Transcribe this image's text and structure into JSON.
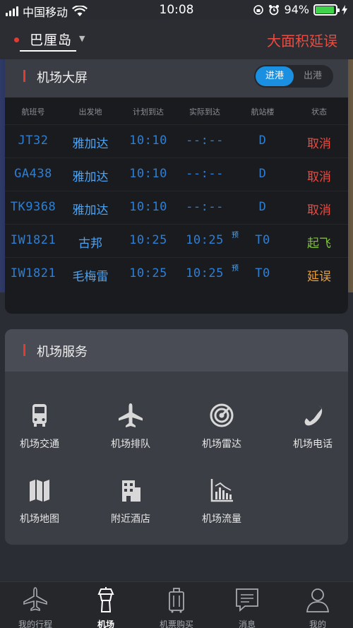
{
  "status": {
    "carrier": "中国移动",
    "time": "10:08",
    "battery": "94%",
    "battery_level": 0.94
  },
  "header": {
    "location": "巴厘岛",
    "delay_link": "大面积延误"
  },
  "board": {
    "title": "机场大屏",
    "toggle": {
      "arrive": "进港",
      "depart": "出港"
    },
    "columns": [
      "航班号",
      "出发地",
      "计划到达",
      "实际到达",
      "航站楼",
      "状态"
    ],
    "flights": [
      {
        "no": "JT32",
        "from": "雅加达",
        "planned": "10:10",
        "actual": "--:--",
        "pre": "",
        "terminal": "D",
        "status": "取消",
        "kind": "cancel"
      },
      {
        "no": "GA438",
        "from": "雅加达",
        "planned": "10:10",
        "actual": "--:--",
        "pre": "",
        "terminal": "D",
        "status": "取消",
        "kind": "cancel"
      },
      {
        "no": "TK9368",
        "from": "雅加达",
        "planned": "10:10",
        "actual": "--:--",
        "pre": "",
        "terminal": "D",
        "status": "取消",
        "kind": "cancel"
      },
      {
        "no": "IW1821",
        "from": "古邦",
        "planned": "10:25",
        "actual": "10:25",
        "pre": "预",
        "terminal": "T0",
        "status": "起飞",
        "kind": "fly"
      },
      {
        "no": "IW1821",
        "from": "毛梅雷",
        "planned": "10:25",
        "actual": "10:25",
        "pre": "预",
        "terminal": "T0",
        "status": "延误",
        "kind": "delay"
      }
    ]
  },
  "services": {
    "title": "机场服务",
    "items": [
      {
        "label": "机场交通",
        "icon": "bus-icon"
      },
      {
        "label": "机场排队",
        "icon": "airplane-icon"
      },
      {
        "label": "机场雷达",
        "icon": "radar-icon"
      },
      {
        "label": "机场电话",
        "icon": "phone-icon"
      },
      {
        "label": "机场地图",
        "icon": "map-icon"
      },
      {
        "label": "附近酒店",
        "icon": "hotel-icon"
      },
      {
        "label": "机场流量",
        "icon": "chart-icon"
      }
    ]
  },
  "tabs": [
    {
      "label": "我的行程",
      "icon": "airplane-icon",
      "active": false
    },
    {
      "label": "机场",
      "icon": "tower-icon",
      "active": true
    },
    {
      "label": "机票购买",
      "icon": "luggage-icon",
      "active": false
    },
    {
      "label": "消息",
      "icon": "message-icon",
      "active": false
    },
    {
      "label": "我的",
      "icon": "user-icon",
      "active": false
    }
  ],
  "colors": {
    "accent": "#1b8fe0",
    "red": "#ef4a3f",
    "green": "#7fc23b",
    "orange": "#f0a23a",
    "led": "#2d7fd4"
  }
}
